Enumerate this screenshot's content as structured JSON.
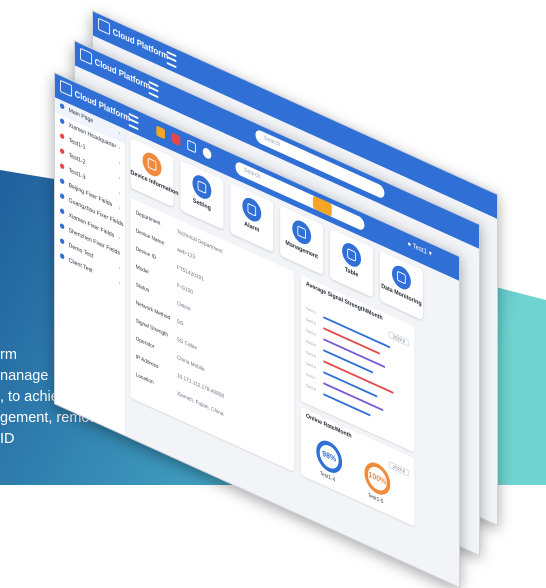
{
  "caption_lines": [
    "rm",
    "nanage",
    ", to achieve",
    "gement, remote",
    "                ID"
  ],
  "topbar": {
    "brand": "Cloud Platform",
    "search_placeholder": "Search",
    "user": "Test1"
  },
  "sidebar": {
    "items": [
      {
        "label": "Main Page",
        "icon": "home-icon",
        "color": "#2f6fd6"
      },
      {
        "label": "Xiamen Headquarter",
        "icon": "dot-icon",
        "color": "#2f6fd6"
      },
      {
        "label": "Test1-1",
        "icon": "dot-icon",
        "color": "#e54848"
      },
      {
        "label": "Test1-2",
        "icon": "dot-icon",
        "color": "#e54848"
      },
      {
        "label": "Test1-3",
        "icon": "dot-icon",
        "color": "#e54848"
      },
      {
        "label": "Beijing Fixer Fields",
        "icon": "square-icon",
        "color": "#2f6fd6"
      },
      {
        "label": "Guangzhou Fixer Fields",
        "icon": "wave-icon",
        "color": "#2f6fd6"
      },
      {
        "label": "Xiamen Fixer Fields",
        "icon": "grid-icon",
        "color": "#2f6fd6"
      },
      {
        "label": "Shenzhen Fixer Fields",
        "icon": "grid-icon",
        "color": "#2f6fd6"
      },
      {
        "label": "Demo Test",
        "icon": "square-icon",
        "color": "#2f6fd6"
      },
      {
        "label": "Client Test",
        "icon": "wave-icon",
        "color": "#2f6fd6"
      }
    ]
  },
  "tiles": [
    {
      "label": "Device Information",
      "color": "#f08a3c"
    },
    {
      "label": "Setting",
      "color": "#2f6fd6"
    },
    {
      "label": "Alarm",
      "color": "#2f6fd6"
    },
    {
      "label": "Management",
      "color": "#2f6fd6"
    },
    {
      "label": "Table",
      "color": "#2f6fd6"
    },
    {
      "label": "Data Monitoring",
      "color": "#2f6fd6"
    }
  ],
  "device_info": {
    "rows": [
      {
        "k": "Department",
        "v": "Technical Department"
      },
      {
        "k": "Device Name",
        "v": "web-123"
      },
      {
        "k": "Device ID",
        "v": "FT51420191"
      },
      {
        "k": "Model",
        "v": "F-G100"
      },
      {
        "k": "Status",
        "v": "Online"
      },
      {
        "k": "Network Method",
        "v": "5G"
      },
      {
        "k": "Signal Strength",
        "v": "5G      Cable"
      },
      {
        "k": "Operator",
        "v": "China Mobile"
      },
      {
        "k": "IP Address",
        "v": "10.171.112.178:40808"
      },
      {
        "k": "Location",
        "v": "Xiamen, Fujian, China"
      }
    ]
  },
  "signal_panel": {
    "title": "Average Signal Strength/Month",
    "selector": "2019.8",
    "bars": [
      {
        "label": "Test1-1",
        "value": 0.78,
        "color": "#2f6fd6"
      },
      {
        "label": "Test1-2",
        "value": 0.66,
        "color": "#e54848"
      },
      {
        "label": "Test1-3",
        "value": 0.72,
        "color": "#7a5bd6"
      },
      {
        "label": "Test1-4",
        "value": 0.58,
        "color": "#2f6fd6"
      },
      {
        "label": "Test1-5",
        "value": 0.82,
        "color": "#e54848"
      },
      {
        "label": "Test1-6",
        "value": 0.63,
        "color": "#2f6fd6"
      },
      {
        "label": "Test1-7",
        "value": 0.7,
        "color": "#7a5bd6"
      },
      {
        "label": "Test1-8",
        "value": 0.55,
        "color": "#2f6fd6"
      }
    ]
  },
  "online_panel": {
    "title": "Online Rate/Month",
    "selector": "2019.8",
    "rings": [
      {
        "value": "98%",
        "label": "Test1-4",
        "color": "#2f6fd6"
      },
      {
        "value": "100%",
        "label": "Test1-5",
        "color": "#f08a3c"
      }
    ]
  },
  "colors": {
    "topbar": "#2f6fd6",
    "accent": "#f5a524",
    "bg_gradient_start": "#1f5f9c",
    "bg_gradient_end": "#6fd3d0"
  }
}
